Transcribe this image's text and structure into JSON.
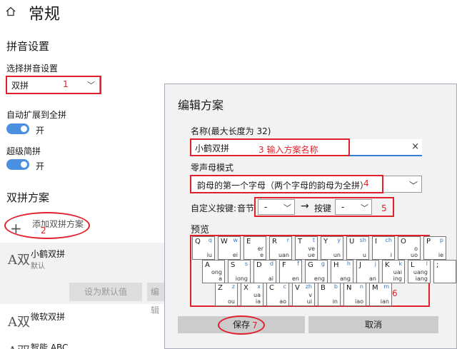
{
  "page": {
    "title": "常规",
    "home_icon": "home-icon"
  },
  "pinyin_section": {
    "title": "拼音设置",
    "select_label": "选择拼音设置",
    "select_value": "双拼"
  },
  "auto_expand": {
    "label": "自动扩展到全拼",
    "state": "开"
  },
  "super_short": {
    "label": "超级简拼",
    "state": "开"
  },
  "shuangpin_section": {
    "title": "双拼方案",
    "add_label": "添加双拼方案"
  },
  "schemes": [
    {
      "icon": "A双",
      "name": "小鹤双拼",
      "sub": "默认"
    },
    {
      "icon": "A双",
      "name": "微软双拼"
    },
    {
      "icon": "A双",
      "name": "智能 ABC"
    }
  ],
  "scheme_buttons": {
    "set_default": "设为默认值",
    "edit": "编辑"
  },
  "dialog": {
    "title": "编辑方案",
    "name_label": "名称(最大长度为 32)",
    "name_value": "小鹤双拼",
    "zero_label": "零声母模式",
    "zero_value": "韵母的第一个字母（两个字母的韵母为全拼）",
    "custom_label": "自定义按键:",
    "syllable_label": "音节",
    "syllable_value": "-",
    "key_label": "按键",
    "key_value": "-",
    "preview_label": "预览",
    "save": "保存",
    "cancel": "取消"
  },
  "annotations": {
    "n1": "1",
    "n2": "2",
    "n3": "3 输入方案名称",
    "n4": "4",
    "n5": "5",
    "n6": "6",
    "n7": "7"
  },
  "keyboard": {
    "rows": [
      [
        {
          "k": "Q",
          "s": "q",
          "f": "iu"
        },
        {
          "k": "W",
          "s": "w",
          "f": "ei"
        },
        {
          "k": "E",
          "s": "",
          "f": "e"
        },
        {
          "k": "R",
          "s": "r",
          "f": "uan"
        },
        {
          "k": "T",
          "s": "t",
          "f": "ue"
        },
        {
          "k": "Y",
          "s": "y",
          "f": "un"
        },
        {
          "k": "U",
          "s": "sh",
          "f": "u"
        },
        {
          "k": "I",
          "s": "ch",
          "f": "i"
        },
        {
          "k": "O",
          "s": "",
          "f": "uo"
        },
        {
          "k": "P",
          "s": "p",
          "f": "ie"
        }
      ],
      [
        {
          "k": "A",
          "s": "",
          "f": "a"
        },
        {
          "k": "S",
          "s": "s",
          "f": "iong"
        },
        {
          "k": "D",
          "s": "d",
          "f": "ai"
        },
        {
          "k": "F",
          "s": "f",
          "f": "en"
        },
        {
          "k": "G",
          "s": "g",
          "f": "eng"
        },
        {
          "k": "H",
          "s": "h",
          "f": "ang"
        },
        {
          "k": "J",
          "s": "j",
          "f": "an"
        },
        {
          "k": "K",
          "s": "k",
          "f": "ing"
        },
        {
          "k": "L",
          "s": "l",
          "f": "iang"
        },
        {
          "k": ";",
          "s": "",
          "f": ""
        }
      ],
      [
        {
          "k": "Z",
          "s": "z",
          "f": "ou"
        },
        {
          "k": "X",
          "s": "x",
          "f": "ia"
        },
        {
          "k": "C",
          "s": "c",
          "f": "ao"
        },
        {
          "k": "V",
          "s": "zh",
          "f": "ui"
        },
        {
          "k": "B",
          "s": "b",
          "f": "in"
        },
        {
          "k": "N",
          "s": "n",
          "f": "iao"
        },
        {
          "k": "M",
          "s": "m",
          "f": "ian"
        }
      ]
    ],
    "row2_extra": [
      "ong",
      "",
      "",
      "",
      "",
      "",
      "",
      "uai",
      "uang",
      ""
    ],
    "row1_extra": [
      "",
      "",
      "er",
      "",
      "ve",
      "",
      "",
      "",
      "o",
      ""
    ],
    "row3_extra": [
      "",
      "ua",
      "",
      "v",
      "",
      "",
      ""
    ]
  }
}
